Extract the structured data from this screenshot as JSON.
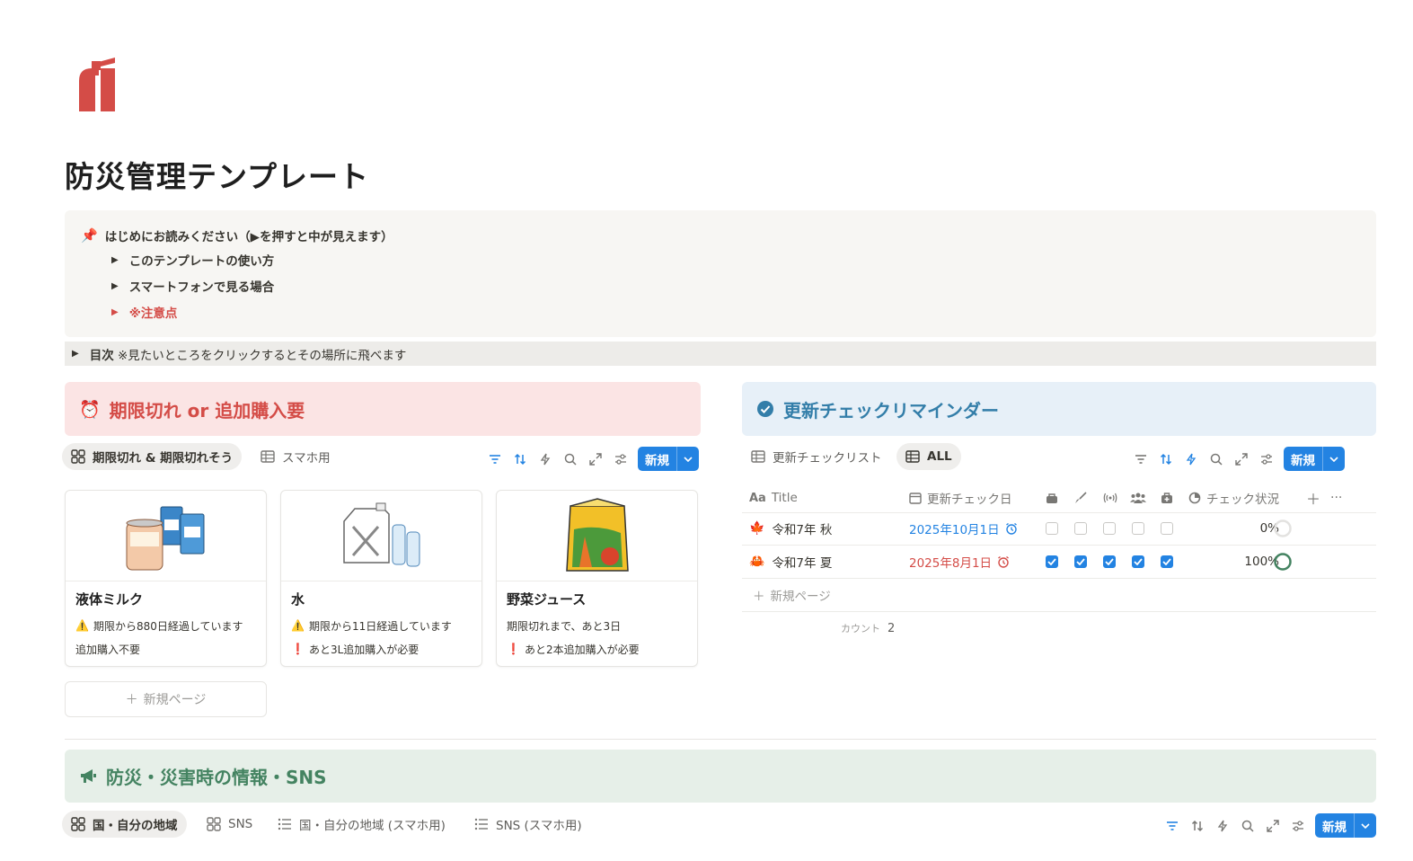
{
  "page": {
    "title": "防災管理テンプレート"
  },
  "callout": {
    "heading": "はじめにお読みください（▶を押すと中が見えます）",
    "items": [
      {
        "label": "このテンプレートの使い方"
      },
      {
        "label": "スマートフォンで見る場合"
      },
      {
        "label": "※注意点"
      }
    ]
  },
  "toc": {
    "label": "目次",
    "note": "※見たいところをクリックするとその場所に飛べます"
  },
  "expiry": {
    "header": "期限切れ or 追加購入要",
    "tabs": [
      {
        "label": "期限切れ & 期限切れそう"
      },
      {
        "label": "スマホ用"
      }
    ],
    "new_button": "新規",
    "cards": [
      {
        "title": "液体ミルク",
        "line1": "期限から880日経過しています",
        "line2": "追加購入不要"
      },
      {
        "title": "水",
        "line1": "期限から11日経過しています",
        "line2": "あと3L追加購入が必要"
      },
      {
        "title": "野菜ジュース",
        "line1": "期限切れまで、あと3日",
        "line2": "あと2本追加購入が必要"
      }
    ],
    "new_page": "新規ページ"
  },
  "reminder": {
    "header": "更新チェックリマインダー",
    "tabs": [
      {
        "label": "更新チェックリスト"
      },
      {
        "label": "ALL"
      }
    ],
    "new_button": "新規",
    "columns": {
      "title": "Title",
      "date": "更新チェック日",
      "status": "チェック状況"
    },
    "rows": [
      {
        "title": "令和7年 秋",
        "date": "2025年10月1日",
        "checks": [
          false,
          false,
          false,
          false,
          false
        ],
        "progress": "0%"
      },
      {
        "title": "令和7年 夏",
        "date": "2025年8月1日",
        "checks": [
          true,
          true,
          true,
          true,
          true
        ],
        "progress": "100%"
      }
    ],
    "new_page": "新規ページ",
    "count_label": "カウント",
    "count_value": "2"
  },
  "info": {
    "header": "防災・災害時の情報・SNS",
    "tabs": [
      {
        "label": "国・自分の地域"
      },
      {
        "label": "SNS"
      },
      {
        "label": "国・自分の地域 (スマホ用)"
      },
      {
        "label": "SNS (スマホ用)"
      }
    ],
    "new_button": "新規"
  },
  "colors": {
    "accent": "#2383e2",
    "red": "#d44c47",
    "blue": "#337ea9",
    "green": "#448361"
  }
}
